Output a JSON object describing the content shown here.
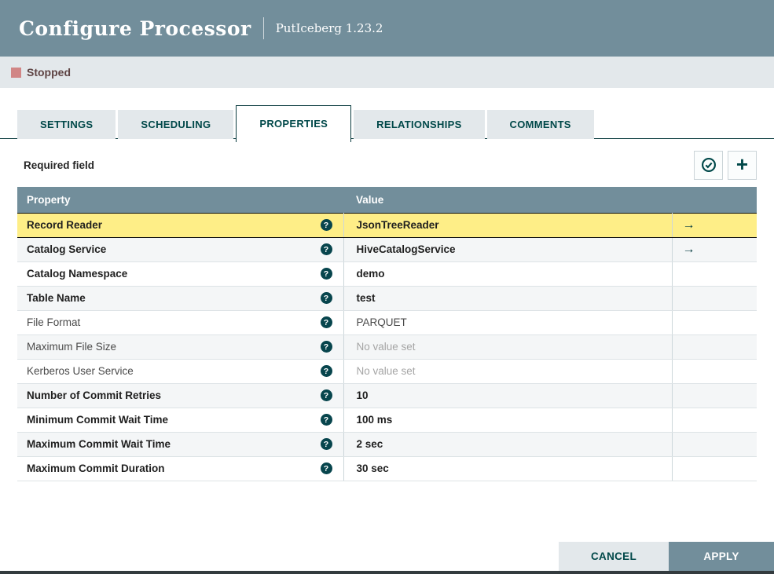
{
  "dialog": {
    "title": "Configure Processor",
    "subtitle": "PutIceberg 1.23.2"
  },
  "status": {
    "label": "Stopped",
    "icon": "stopped-square-icon"
  },
  "tabs": [
    {
      "label": "SETTINGS",
      "active": false
    },
    {
      "label": "SCHEDULING",
      "active": false
    },
    {
      "label": "PROPERTIES",
      "active": true
    },
    {
      "label": "RELATIONSHIPS",
      "active": false
    },
    {
      "label": "COMMENTS",
      "active": false
    }
  ],
  "toolbar": {
    "required_note": "Required field",
    "verify_button_icon": "verify-check-circle-icon",
    "add_button_icon": "plus-icon",
    "plus_glyph": "+"
  },
  "table": {
    "columns": [
      "Property",
      "Value"
    ],
    "help_icon_glyph": "?",
    "goto_icon_glyph": "→",
    "rows": [
      {
        "property": "Record Reader",
        "value": "JsonTreeReader",
        "required": true,
        "highlighted": true,
        "has_link": true,
        "unset": false
      },
      {
        "property": "Catalog Service",
        "value": "HiveCatalogService",
        "required": true,
        "highlighted": false,
        "has_link": true,
        "unset": false
      },
      {
        "property": "Catalog Namespace",
        "value": "demo",
        "required": true,
        "highlighted": false,
        "has_link": false,
        "unset": false
      },
      {
        "property": "Table Name",
        "value": "test",
        "required": true,
        "highlighted": false,
        "has_link": false,
        "unset": false
      },
      {
        "property": "File Format",
        "value": "PARQUET",
        "required": false,
        "highlighted": false,
        "has_link": false,
        "unset": false
      },
      {
        "property": "Maximum File Size",
        "value": "No value set",
        "required": false,
        "highlighted": false,
        "has_link": false,
        "unset": true
      },
      {
        "property": "Kerberos User Service",
        "value": "No value set",
        "required": false,
        "highlighted": false,
        "has_link": false,
        "unset": true
      },
      {
        "property": "Number of Commit Retries",
        "value": "10",
        "required": true,
        "highlighted": false,
        "has_link": false,
        "unset": false
      },
      {
        "property": "Minimum Commit Wait Time",
        "value": "100 ms",
        "required": true,
        "highlighted": false,
        "has_link": false,
        "unset": false
      },
      {
        "property": "Maximum Commit Wait Time",
        "value": "2 sec",
        "required": true,
        "highlighted": false,
        "has_link": false,
        "unset": false
      },
      {
        "property": "Maximum Commit Duration",
        "value": "30 sec",
        "required": true,
        "highlighted": false,
        "has_link": false,
        "unset": false
      }
    ]
  },
  "footer": {
    "cancel_label": "CANCEL",
    "apply_label": "APPLY"
  },
  "colors": {
    "header_bg": "#728e9b",
    "accent_teal": "#004849",
    "status_bar_bg": "#e3e8eb",
    "stopped_icon": "#d18686",
    "stopped_text": "#5e4343",
    "highlight_row": "#feee87",
    "alt_row_bg": "#f4f6f7",
    "cancel_button_bg": "#e3e8eb",
    "apply_button_bg": "#728e9b"
  }
}
